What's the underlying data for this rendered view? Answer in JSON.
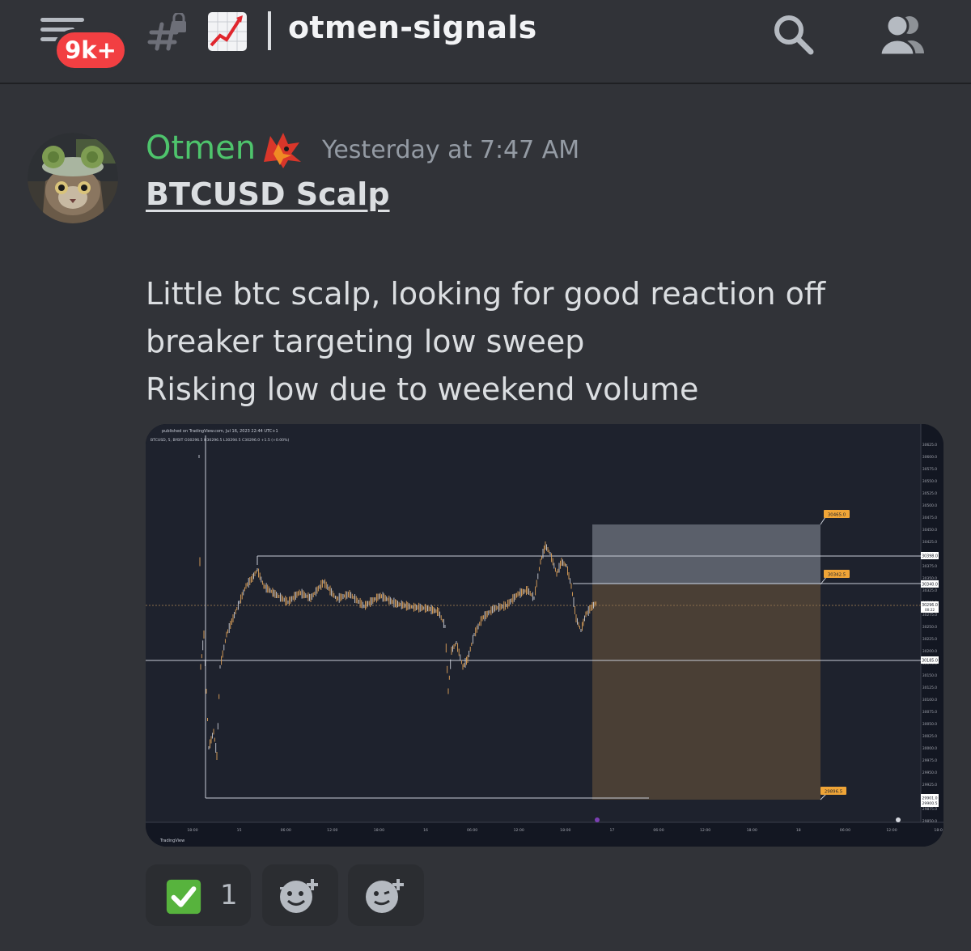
{
  "header": {
    "badge": "9k+",
    "channel_name": "otmen-signals",
    "icons": [
      "menu-icon",
      "locked-channel-icon",
      "chart-increasing-emoji",
      "search-icon",
      "members-icon"
    ]
  },
  "message": {
    "author": "Otmen",
    "author_color": "#4ec46c",
    "author_emoji": "wolf-emoji",
    "timestamp": "Yesterday at 7:47 AM",
    "title": "BTCUSD Scalp",
    "lines": [
      "Little btc scalp, looking for good reaction off",
      "breaker targeting low sweep",
      "Risking low due to weekend volume"
    ]
  },
  "attachment": {
    "published": "published on TradingView.com, Jul 16, 2023 22:44 UTC+1",
    "ticker_line": "BTCUSD, 5, BYBIT  O30296.5  H30296.5  L30294.5  C30296.0  +1.5 (+0.00%)",
    "watermark": "TradingView",
    "price_axis": [
      "30625.0",
      "30600.0",
      "30575.0",
      "30550.0",
      "30525.0",
      "30500.0",
      "30475.0",
      "30450.0",
      "30425.0",
      "30400.0",
      "30375.0",
      "30350.0",
      "30325.0",
      "30300.0",
      "30275.0",
      "30250.0",
      "30225.0",
      "30200.0",
      "30175.0",
      "30150.0",
      "30125.0",
      "30100.0",
      "30075.0",
      "30050.0",
      "30025.0",
      "30000.0",
      "29975.0",
      "29950.0",
      "29925.0",
      "29900.0",
      "29875.0",
      "29850.0"
    ],
    "time_axis": [
      "18:00",
      "15",
      "06:00",
      "12:00",
      "18:00",
      "16",
      "06:00",
      "12:00",
      "18:00",
      "17",
      "06:00",
      "12:00",
      "18:00",
      "18",
      "06:00",
      "12:00",
      "18:0"
    ],
    "labels": {
      "take_profit": "30465.0",
      "entry": "30342.5",
      "stop": "29896.5",
      "level_high": "30398.0",
      "level_entry": "30340.0",
      "current": "30296.0",
      "current_time": "00:22",
      "level_low": "30185.0",
      "low_1": "29901.0",
      "low_2": "29900.5"
    }
  },
  "reactions": [
    {
      "emoji": "check-mark-emoji",
      "count": "1"
    },
    {
      "emoji": "add-reaction-icon",
      "count": ""
    },
    {
      "emoji": "add-super-reaction-icon",
      "count": ""
    }
  ]
}
